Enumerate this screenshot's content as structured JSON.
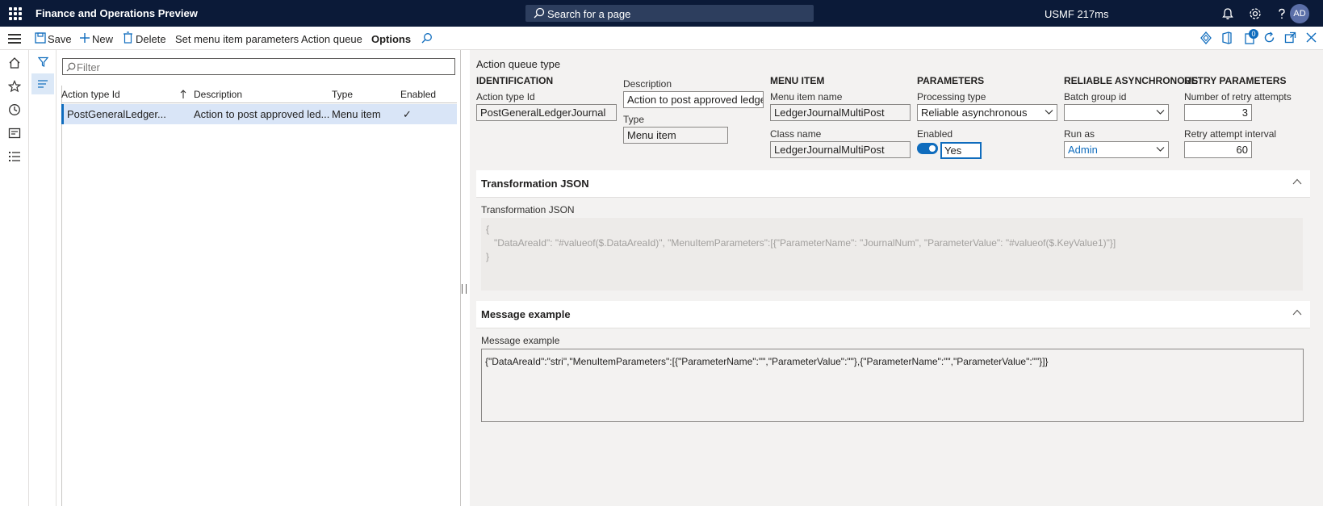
{
  "topbar": {
    "app_title": "Finance and Operations Preview",
    "search_placeholder": "Search for a page",
    "company": "USMF 217ms",
    "avatar_initials": "AD"
  },
  "actionbar": {
    "save": "Save",
    "new": "New",
    "delete": "Delete",
    "set_params": "Set menu item parameters",
    "action_queue": "Action queue",
    "options": "Options",
    "notification_count": "0"
  },
  "list": {
    "filter_placeholder": "Filter",
    "columns": [
      "Action type Id",
      "Description",
      "Type",
      "Enabled"
    ],
    "rows": [
      {
        "id": "PostGeneralLedger...",
        "description": "Action to post approved led...",
        "type": "Menu item",
        "enabled": "✓"
      }
    ]
  },
  "detail": {
    "title": "Action queue type",
    "identification": {
      "header": "IDENTIFICATION",
      "action_type_id_label": "Action type Id",
      "action_type_id": "PostGeneralLedgerJournal",
      "description_label": "Description",
      "description": "Action to post approved ledger",
      "type_label": "Type",
      "type": "Menu item"
    },
    "menu_item": {
      "header": "MENU ITEM",
      "name_label": "Menu item name",
      "name": "LedgerJournalMultiPost",
      "class_label": "Class name",
      "class": "LedgerJournalMultiPost"
    },
    "parameters": {
      "header": "PARAMETERS",
      "processing_label": "Processing type",
      "processing": "Reliable asynchronous",
      "enabled_label": "Enabled",
      "enabled": "Yes"
    },
    "reliable": {
      "header": "RELIABLE ASYNCHRONOUS",
      "batch_label": "Batch group id",
      "batch": "",
      "run_as_label": "Run as",
      "run_as": "Admin"
    },
    "retry": {
      "header": "RETRY PARAMETERS",
      "attempts_label": "Number of retry attempts",
      "attempts": "3",
      "interval_label": "Retry attempt interval",
      "interval": "60"
    },
    "transformation": {
      "header": "Transformation JSON",
      "field_label": "Transformation JSON",
      "value": "{\n   \"DataAreaId\": \"#valueof($.DataAreaId)\", \"MenuItemParameters\":[{\"ParameterName\": \"JournalNum\", \"ParameterValue\": \"#valueof($.KeyValue1)\"}]\n}"
    },
    "message": {
      "header": "Message example",
      "field_label": "Message example",
      "value": "{\"DataAreaId\":\"stri\",\"MenuItemParameters\":[{\"ParameterName\":\"\",\"ParameterValue\":\"\"},{\"ParameterName\":\"\",\"ParameterValue\":\"\"}]}"
    }
  }
}
